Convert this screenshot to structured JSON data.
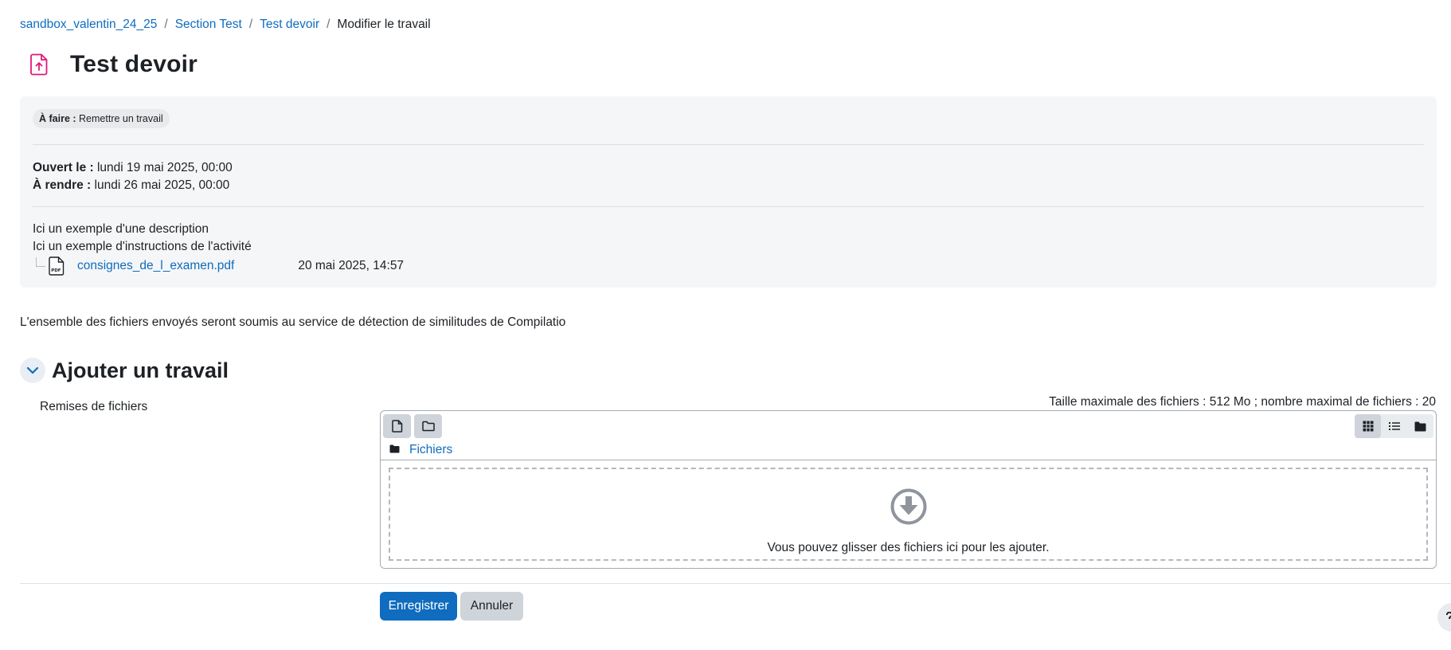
{
  "breadcrumb": {
    "items": [
      "sandbox_valentin_24_25",
      "Section Test",
      "Test devoir"
    ],
    "current": "Modifier le travail",
    "separator": "/"
  },
  "page": {
    "title": "Test devoir",
    "icon": "assignment-upload-icon",
    "accent_color": "#e0197d"
  },
  "activity": {
    "todo_label": "À faire :",
    "todo_value": "Remettre un travail",
    "opened_label": "Ouvert le :",
    "opened_value": "lundi 19 mai 2025, 00:00",
    "due_label": "À rendre :",
    "due_value": "lundi 26 mai 2025, 00:00",
    "description": "Ici un exemple d'une description",
    "instructions": "Ici un exemple d'instructions de l'activité",
    "attachment": {
      "name": "consignes_de_l_examen.pdf",
      "date": "20 mai 2025, 14:57",
      "icon": "pdf-file-icon"
    }
  },
  "plagiarism_notice": "L'ensemble des fichiers envoyés seront soumis au service de détection de similitudes de Compilatio",
  "section": {
    "title": "Ajouter un travail",
    "field_label": "Remises de fichiers",
    "file_limits": "Taille maximale des fichiers : 512 Mo ; nombre maximal de fichiers : 20"
  },
  "filemanager": {
    "path_label": "Fichiers",
    "drop_message": "Vous pouvez glisser des fichiers ici pour les ajouter.",
    "toolbar_icons": [
      "add-file-icon",
      "create-folder-icon"
    ],
    "view_icons": [
      "grid-view-icon",
      "list-view-icon",
      "tree-view-icon"
    ]
  },
  "buttons": {
    "save": "Enregistrer",
    "cancel": "Annuler"
  },
  "colors": {
    "link": "#0f6cbf",
    "primary": "#0f6cbf",
    "secondary": "#ced4da"
  }
}
